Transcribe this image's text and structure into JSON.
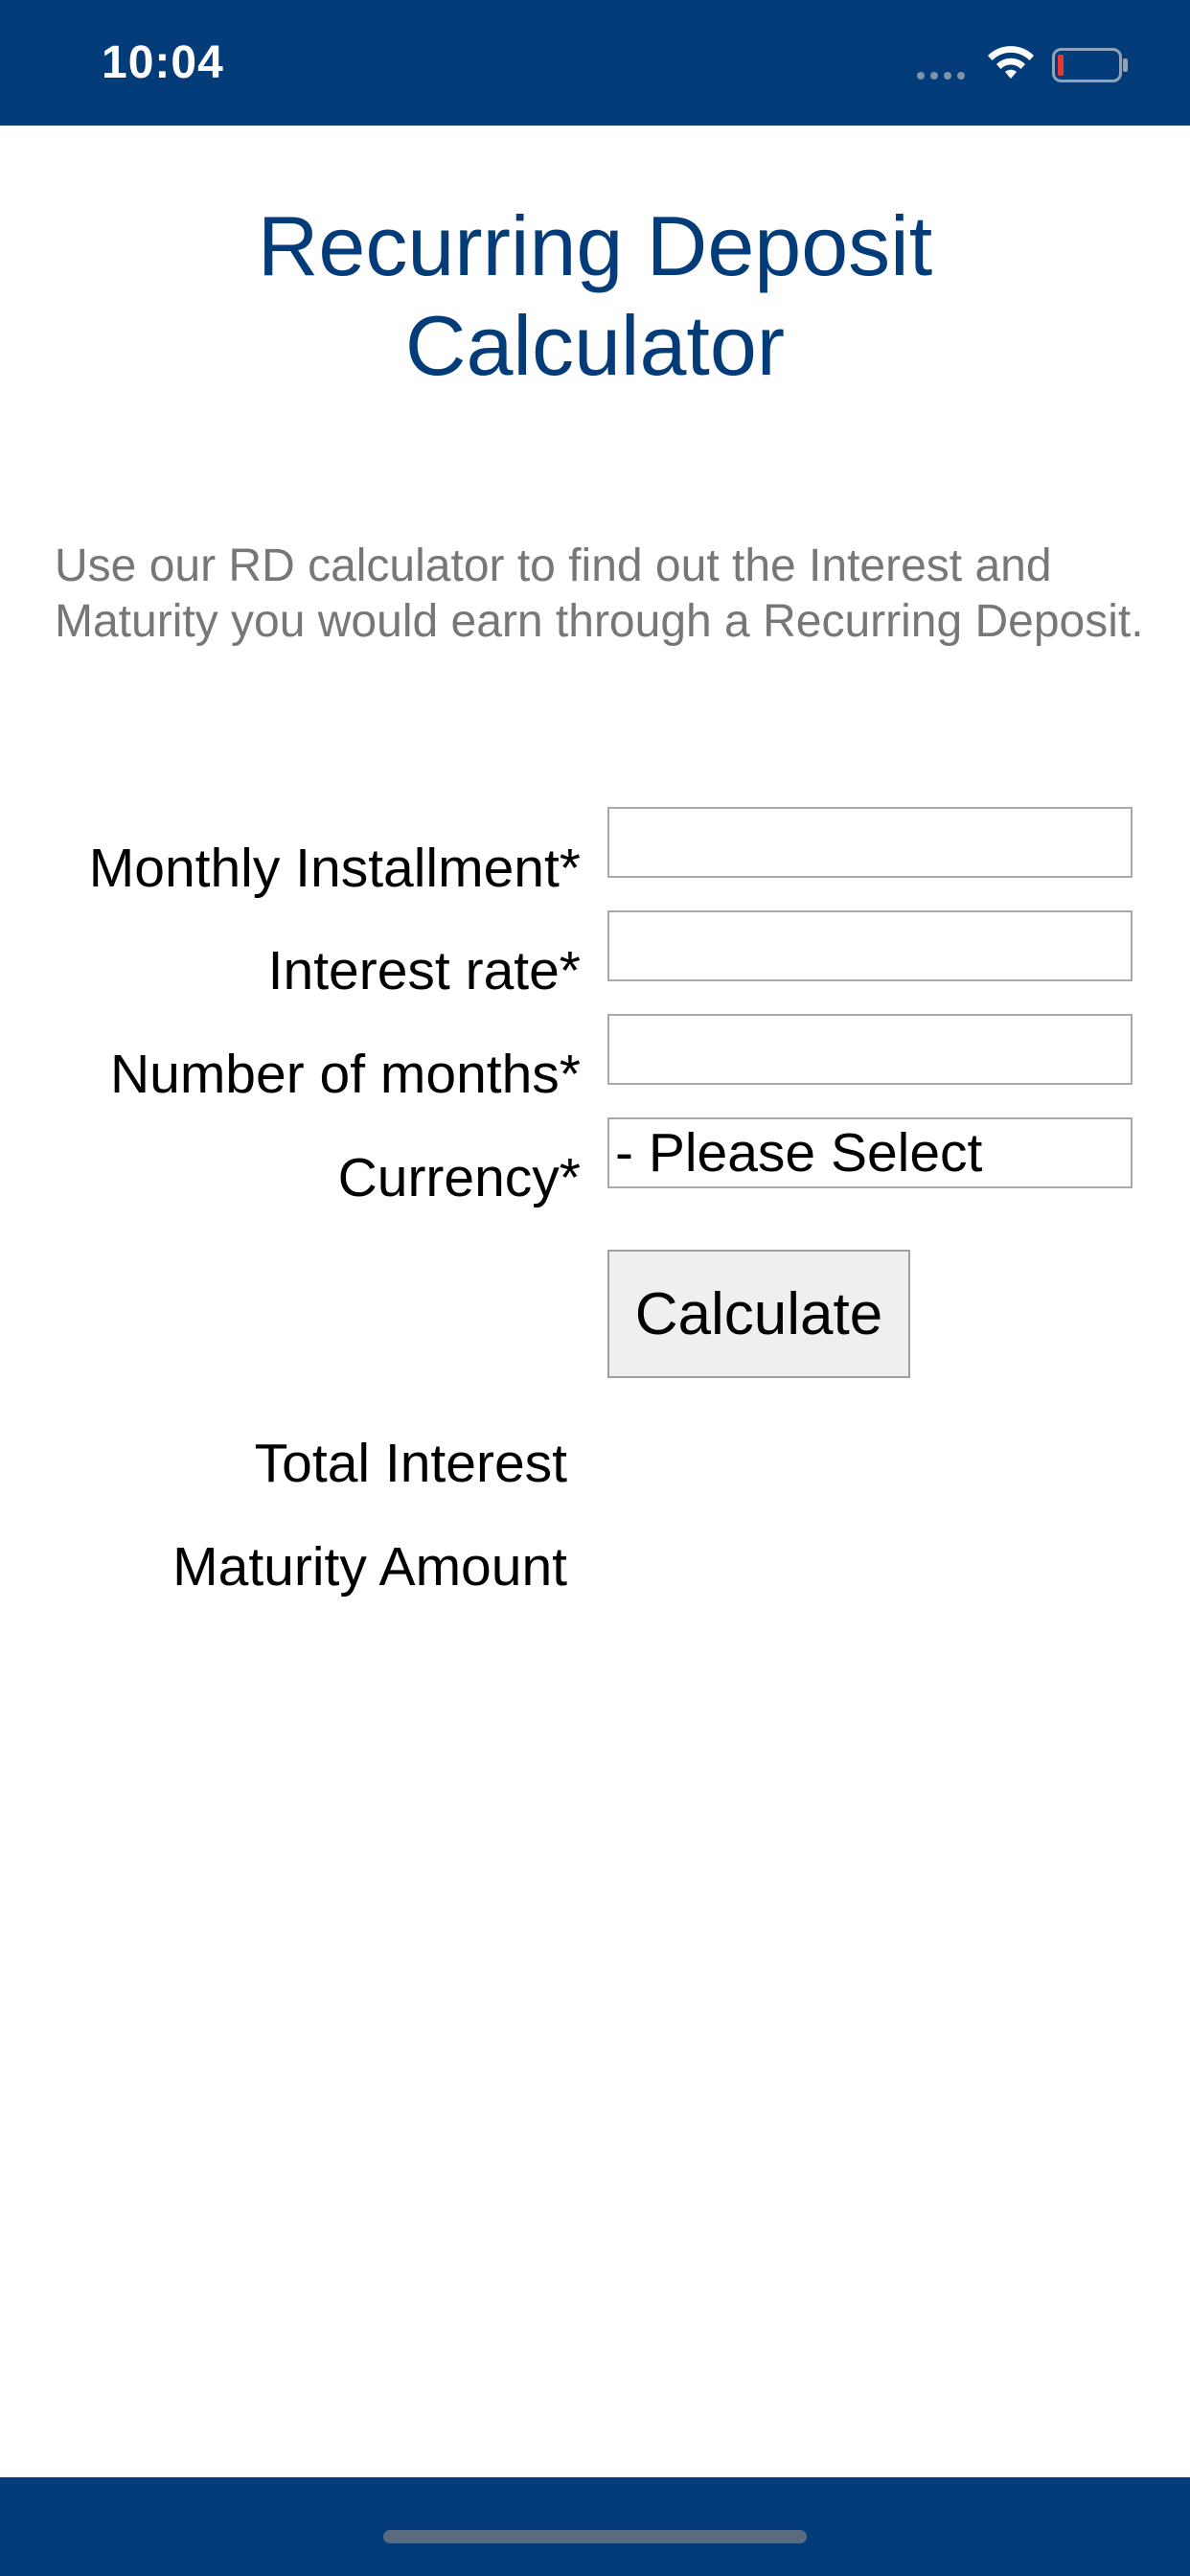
{
  "status_bar": {
    "time": "10:04",
    "signal_icon": "cellular-signal-icon",
    "wifi_icon": "wifi-icon",
    "battery_icon": "battery-low-icon",
    "background_color": "#033c78",
    "battery_level_color": "#e53935"
  },
  "header": {
    "title_line1": "Recurring Deposit",
    "title_line2": "Calculator",
    "title_color": "#033c78"
  },
  "intro": {
    "description": "Use our RD calculator to find out the Interest and Maturity you would earn through a Recurring Deposit."
  },
  "form": {
    "monthly_installment": {
      "label": "Monthly Installment*",
      "value": ""
    },
    "interest_rate": {
      "label": "Interest rate*",
      "value": ""
    },
    "number_of_months": {
      "label": "Number of months*",
      "value": ""
    },
    "currency": {
      "label": "Currency*",
      "selected": "- Please Select"
    },
    "calculate_button": "Calculate"
  },
  "results": {
    "total_interest_label": "Total Interest",
    "maturity_amount_label": "Maturity Amount"
  },
  "bottom_bar": {
    "home_indicator": "home-indicator",
    "background_color": "#033c78"
  }
}
